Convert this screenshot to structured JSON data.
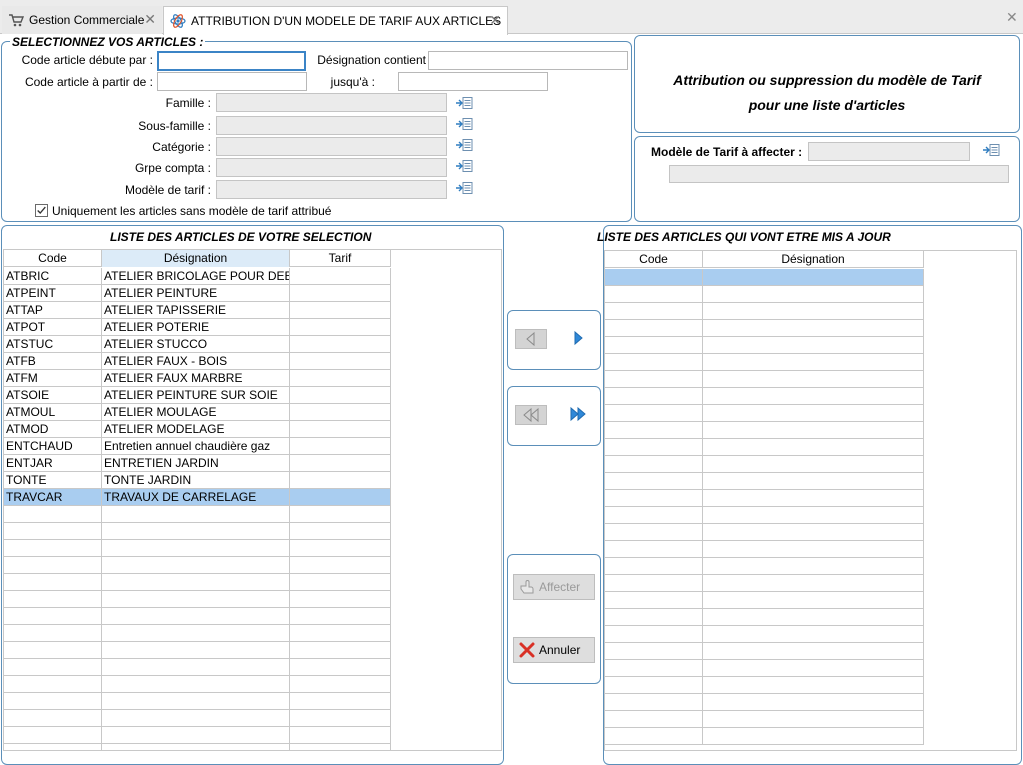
{
  "tabs": [
    {
      "label": "Gestion Commerciale"
    },
    {
      "label": "ATTRIBUTION D'UN MODELE DE TARIF AUX ARTICLES"
    }
  ],
  "selection": {
    "title": "SELECTIONNEZ VOS ARTICLES :",
    "code_starts_label": "Code article débute par :",
    "designation_contains_label": "Désignation contient",
    "code_from_label": "Code article à partir de :",
    "until_label": "jusqu'à :",
    "famille_label": "Famille :",
    "sous_famille_label": "Sous-famille :",
    "categorie_label": "Catégorie :",
    "grpe_compta_label": "Grpe compta :",
    "modele_tarif_label": "Modèle de tarif :",
    "only_without_model_label": "Uniquement les articles sans modèle de tarif attribué",
    "only_without_model_checked": true
  },
  "info": {
    "line1": "Attribution ou suppression du modèle de Tarif",
    "line2": "pour une liste d'articles"
  },
  "assign": {
    "label": "Modèle de Tarif à affecter :"
  },
  "left_list": {
    "title": "LISTE DES ARTICLES DE VOTRE SELECTION",
    "columns": [
      "Code",
      "Désignation",
      "Tarif"
    ],
    "rows": [
      [
        "ATBRIC",
        "ATELIER BRICOLAGE POUR DEB",
        ""
      ],
      [
        "ATPEINT",
        "ATELIER PEINTURE",
        ""
      ],
      [
        "ATTAP",
        "ATELIER TAPISSERIE",
        ""
      ],
      [
        "ATPOT",
        "ATELIER POTERIE",
        ""
      ],
      [
        "ATSTUC",
        "ATELIER STUCCO",
        ""
      ],
      [
        "ATFB",
        "ATELIER FAUX - BOIS",
        ""
      ],
      [
        "ATFM",
        "ATELIER FAUX MARBRE",
        ""
      ],
      [
        "ATSOIE",
        "ATELIER PEINTURE SUR SOIE",
        ""
      ],
      [
        "ATMOUL",
        "ATELIER MOULAGE",
        ""
      ],
      [
        "ATMOD",
        "ATELIER MODELAGE",
        ""
      ],
      [
        "ENTCHAUD",
        "Entretien annuel chaudière gaz",
        ""
      ],
      [
        "ENTJAR",
        "ENTRETIEN JARDIN",
        ""
      ],
      [
        "TONTE",
        "TONTE JARDIN",
        ""
      ],
      [
        "TRAVCAR",
        "TRAVAUX DE CARRELAGE",
        ""
      ]
    ],
    "selected_row": 13
  },
  "right_list": {
    "title": "LISTE DES ARTICLES QUI VONT ETRE MIS A JOUR",
    "columns": [
      "Code",
      "Désignation"
    ],
    "rows": []
  },
  "actions": {
    "affecter_label": "Affecter",
    "annuler_label": "Annuler"
  },
  "colors": {
    "accent": "#3b84c6",
    "panel_border": "#5b8fb9",
    "selection": "#a9cdf0"
  }
}
